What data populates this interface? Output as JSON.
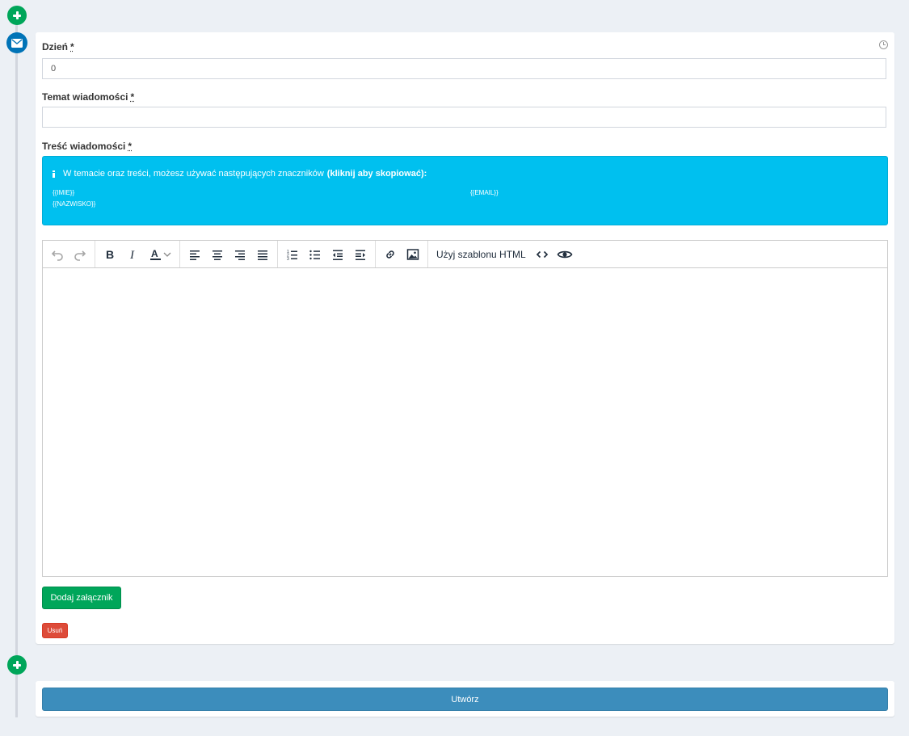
{
  "form": {
    "day_label": "Dzień",
    "required_mark": "*",
    "day_value": "0",
    "subject_label": "Temat wiadomości",
    "subject_value": "",
    "body_label": "Treść wiadomości"
  },
  "info": {
    "text": "W temacie oraz treści, możesz używać następujących znaczników",
    "bold": "(kliknij aby skopiować):",
    "tags": [
      "{{IMIE}}",
      "{{EMAIL}}",
      "{{NAZWISKO}}"
    ]
  },
  "toolbar": {
    "template_label": "Użyj szablonu HTML",
    "icons": [
      "undo-icon",
      "redo-icon",
      "bold-icon",
      "italic-icon",
      "text-color-icon",
      "chevron-down-icon",
      "align-left-icon",
      "align-center-icon",
      "align-right-icon",
      "align-justify-icon",
      "numbered-list-icon",
      "bullet-list-icon",
      "outdent-icon",
      "indent-icon",
      "link-icon",
      "image-icon",
      "code-icon",
      "preview-eye-icon"
    ]
  },
  "buttons": {
    "attach": "Dodaj załącznik",
    "remove": "Usuń",
    "create": "Utwórz"
  },
  "colors": {
    "background": "#ecf0f5",
    "success": "#00a65a",
    "primary": "#3c8dbc",
    "info": "#00c0ef",
    "danger": "#dd4b39",
    "timeline_mail": "#0073b7"
  }
}
